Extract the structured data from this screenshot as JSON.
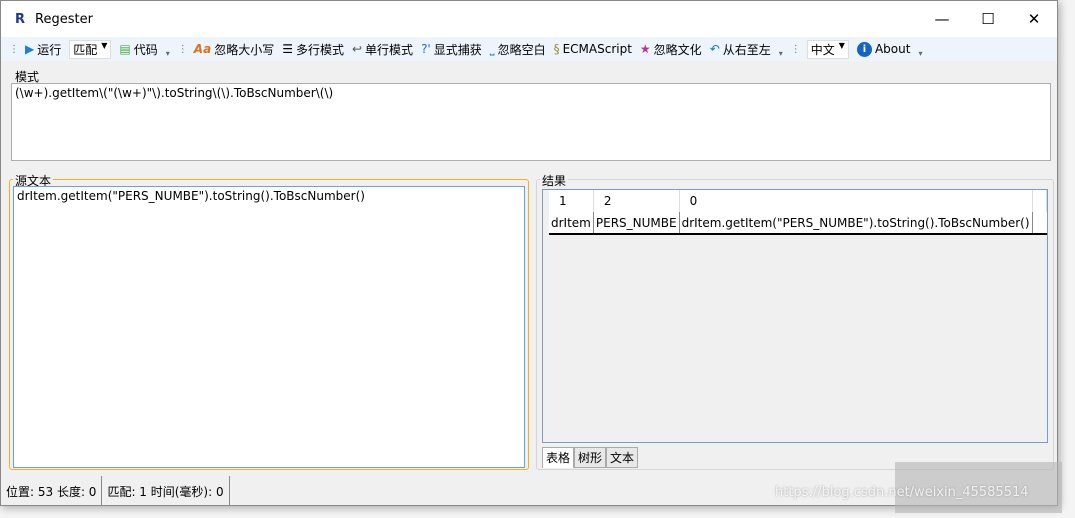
{
  "window": {
    "title": "Regester",
    "logo": "R",
    "minimize": "—",
    "maximize": "☐",
    "close": "✕"
  },
  "toolbar": {
    "run": "运行",
    "mode": "匹配",
    "code": "代码",
    "ignore_case": "忽略大小写",
    "multiline": "多行模式",
    "singleline": "单行模式",
    "explicit_capture": "显式捕获",
    "ignore_whitespace": "忽略空白",
    "ecmascript": "ECMAScript",
    "ignore_culture": "忽略文化",
    "right_to_left": "从右至左",
    "language": "中文",
    "about": "About"
  },
  "pattern": {
    "label": "模式",
    "value": "(\\w+).getItem\\(\"(\\w+)\"\\).toString\\(\\).ToBscNumber\\(\\)"
  },
  "source": {
    "label": "源文本",
    "value": "drItem.getItem(\"PERS_NUMBE\").toString().ToBscNumber()"
  },
  "results": {
    "label": "结果",
    "headers": [
      "1",
      "2",
      "0"
    ],
    "rows": [
      [
        "drItem",
        "PERS_NUMBE",
        "drItem.getItem(\"PERS_NUMBE\").toString().ToBscNumber()"
      ]
    ],
    "tabs": [
      "表格",
      "树形",
      "文本"
    ]
  },
  "status": {
    "position": "位置: 53 长度: 0",
    "match": "匹配: 1 时间(毫秒): 0"
  },
  "watermark": "https://blog.csdn.net/weixin_45585514"
}
